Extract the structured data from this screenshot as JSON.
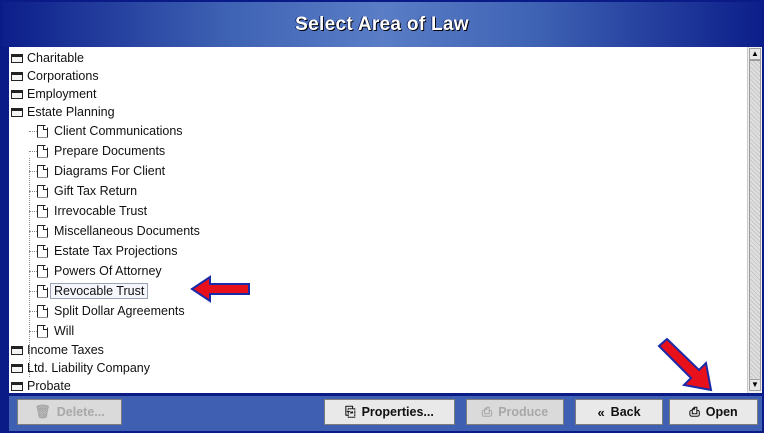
{
  "title": "Select Area of Law",
  "tree": {
    "items": [
      {
        "label": "Charitable",
        "type": "folder"
      },
      {
        "label": "Corporations",
        "type": "folder"
      },
      {
        "label": "Employment",
        "type": "folder"
      },
      {
        "label": "Estate Planning",
        "type": "folder",
        "expanded": true
      },
      {
        "label": "Client Communications",
        "type": "document"
      },
      {
        "label": "Prepare Documents",
        "type": "document"
      },
      {
        "label": "Diagrams For Client",
        "type": "document"
      },
      {
        "label": "Gift Tax Return",
        "type": "document"
      },
      {
        "label": "Irrevocable Trust",
        "type": "document"
      },
      {
        "label": "Miscellaneous Documents",
        "type": "document"
      },
      {
        "label": "Estate Tax Projections",
        "type": "document"
      },
      {
        "label": "Powers Of Attorney",
        "type": "document"
      },
      {
        "label": "Revocable Trust",
        "type": "document",
        "selected": true
      },
      {
        "label": "Split Dollar Agreements",
        "type": "document"
      },
      {
        "label": "Will",
        "type": "document"
      },
      {
        "label": "Income Taxes",
        "type": "folder"
      },
      {
        "label": "Ltd. Liability Company",
        "type": "folder"
      },
      {
        "label": "Probate",
        "type": "folder"
      }
    ]
  },
  "buttons": {
    "delete": "Delete...",
    "properties": "Properties...",
    "produce": "Produce",
    "back": "Back",
    "open": "Open"
  },
  "colors": {
    "frame": "#0a1a86",
    "footer": "#3f5fb2",
    "arrow_red": "#e8101a",
    "arrow_outline": "#1a2aa8"
  }
}
